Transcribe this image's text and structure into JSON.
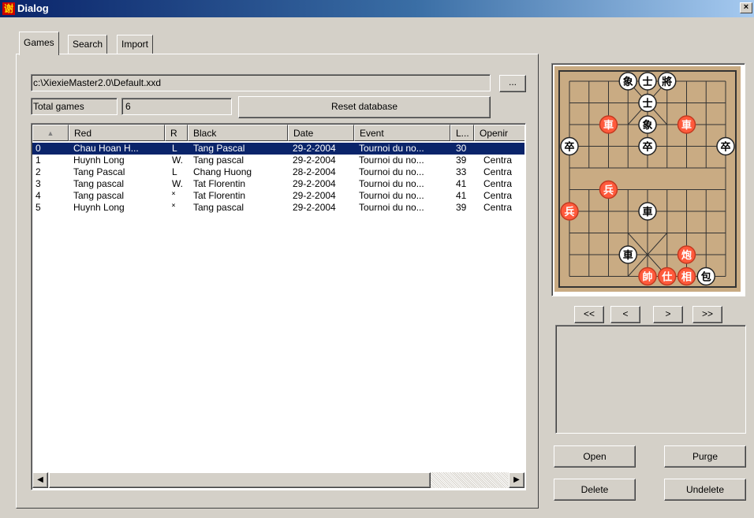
{
  "window": {
    "title": "Dialog",
    "icon_char": "谢",
    "close_symbol": "×"
  },
  "tabs": [
    {
      "label": "Games"
    },
    {
      "label": "Search"
    },
    {
      "label": "Import"
    }
  ],
  "database": {
    "path": "c:\\XiexieMaster2.0\\Default.xxd",
    "browse_label": "...",
    "total_games_label": "Total games",
    "total_games_value": "6",
    "reset_label": "Reset database"
  },
  "games_table": {
    "sort_indicator": "▲",
    "columns": [
      "",
      "Red",
      "R",
      "Black",
      "Date",
      "Event",
      "L...",
      "Openir"
    ],
    "rows": [
      {
        "num": "0",
        "red": "Chau Hoan H...",
        "r": "L",
        "black": "Tang Pascal",
        "date": "29-2-2004",
        "event": "Tournoi du no...",
        "l": "30",
        "opening": ""
      },
      {
        "num": "1",
        "red": "Huynh Long",
        "r": "W.",
        "black": "Tang pascal",
        "date": "29-2-2004",
        "event": "Tournoi du no...",
        "l": "39",
        "opening": "Centra"
      },
      {
        "num": "2",
        "red": "Tang Pascal",
        "r": "L",
        "black": "Chang Huong",
        "date": "28-2-2004",
        "event": "Tournoi du no...",
        "l": "33",
        "opening": "Centra"
      },
      {
        "num": "3",
        "red": "Tang pascal",
        "r": "W.",
        "black": "Tat Florentin",
        "date": "29-2-2004",
        "event": "Tournoi du no...",
        "l": "41",
        "opening": "Centra"
      },
      {
        "num": "4",
        "red": "Tang pascal",
        "r": "˟",
        "black": "Tat Florentin",
        "date": "29-2-2004",
        "event": "Tournoi du no...",
        "l": "41",
        "opening": "Centra"
      },
      {
        "num": "5",
        "red": "Huynh Long",
        "r": "˟",
        "black": "Tang pascal",
        "date": "29-2-2004",
        "event": "Tournoi du no...",
        "l": "39",
        "opening": "Centra"
      }
    ],
    "selected_row": 0,
    "scroll_left": "◀",
    "scroll_right": "▶"
  },
  "board": {
    "colors": {
      "wood": "#c9ab83",
      "line": "#333333",
      "red_piece": "#ff5a3c",
      "black_piece": "#ffffff"
    },
    "pieces": [
      {
        "char": "象",
        "side": "black",
        "file": 3,
        "rank": 0
      },
      {
        "char": "士",
        "side": "black",
        "file": 4,
        "rank": 0
      },
      {
        "char": "將",
        "side": "black",
        "file": 5,
        "rank": 0
      },
      {
        "char": "士",
        "side": "black",
        "file": 4,
        "rank": 1
      },
      {
        "char": "象",
        "side": "black",
        "file": 4,
        "rank": 2
      },
      {
        "char": "卒",
        "side": "black",
        "file": 0,
        "rank": 3
      },
      {
        "char": "卒",
        "side": "black",
        "file": 4,
        "rank": 3
      },
      {
        "char": "卒",
        "side": "black",
        "file": 8,
        "rank": 3
      },
      {
        "char": "車",
        "side": "black",
        "file": 4,
        "rank": 6
      },
      {
        "char": "車",
        "side": "black",
        "file": 3,
        "rank": 8
      },
      {
        "char": "包",
        "side": "black",
        "file": 7,
        "rank": 9
      },
      {
        "char": "車",
        "side": "red",
        "file": 2,
        "rank": 2
      },
      {
        "char": "車",
        "side": "red",
        "file": 6,
        "rank": 2
      },
      {
        "char": "兵",
        "side": "red",
        "file": 2,
        "rank": 5
      },
      {
        "char": "兵",
        "side": "red",
        "file": 0,
        "rank": 6
      },
      {
        "char": "炮",
        "side": "red",
        "file": 6,
        "rank": 8
      },
      {
        "char": "帥",
        "side": "red",
        "file": 4,
        "rank": 9
      },
      {
        "char": "仕",
        "side": "red",
        "file": 5,
        "rank": 9
      },
      {
        "char": "相",
        "side": "red",
        "file": 6,
        "rank": 9
      }
    ]
  },
  "navigation": {
    "first": "<<",
    "prev": "<",
    "next": ">",
    "last": ">>"
  },
  "actions": {
    "open": "Open",
    "purge": "Purge",
    "delete": "Delete",
    "undelete": "Undelete"
  }
}
